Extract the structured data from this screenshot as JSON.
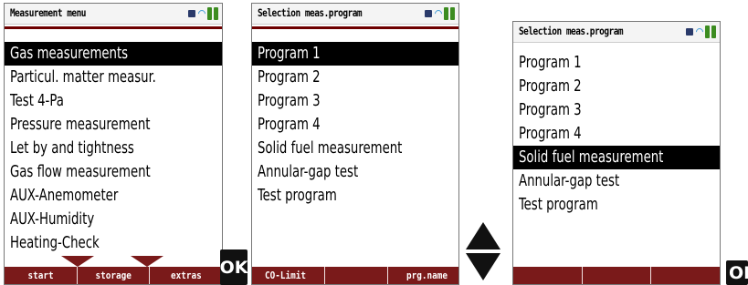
{
  "screen1": {
    "title": "Measurement menu",
    "items": [
      {
        "label": "Gas measurements",
        "selected": true
      },
      {
        "label": "Particul. matter measur.",
        "selected": false
      },
      {
        "label": "Test 4-Pa",
        "selected": false
      },
      {
        "label": "Pressure measurement",
        "selected": false
      },
      {
        "label": "Let by and tightness",
        "selected": false
      },
      {
        "label": "Gas flow measurement",
        "selected": false
      },
      {
        "label": "AUX-Anemometer",
        "selected": false
      },
      {
        "label": "AUX-Humidity",
        "selected": false
      },
      {
        "label": "Heating-Check",
        "selected": false
      }
    ],
    "softkeys": [
      "start",
      "storage",
      "extras"
    ]
  },
  "screen2": {
    "title": "Selection meas.program",
    "items": [
      {
        "label": "Program 1",
        "selected": true
      },
      {
        "label": "Program 2",
        "selected": false
      },
      {
        "label": "Program 3",
        "selected": false
      },
      {
        "label": "Program 4",
        "selected": false
      },
      {
        "label": "Solid fuel measurement",
        "selected": false
      },
      {
        "label": "Annular-gap test",
        "selected": false
      },
      {
        "label": "Test program",
        "selected": false
      }
    ],
    "softkeys": [
      "CO-Limit",
      "",
      "prg.name"
    ]
  },
  "screen3": {
    "title": "Selection meas.program",
    "items": [
      {
        "label": "Program 1",
        "selected": false
      },
      {
        "label": "Program 2",
        "selected": false
      },
      {
        "label": "Program 3",
        "selected": false
      },
      {
        "label": "Program 4",
        "selected": false
      },
      {
        "label": "Solid fuel measurement",
        "selected": true
      },
      {
        "label": "Annular-gap test",
        "selected": false
      },
      {
        "label": "Test program",
        "selected": false
      }
    ],
    "softkeys": [
      "",
      "",
      ""
    ]
  },
  "buttons": {
    "ok1": "OK",
    "ok2": "OK"
  },
  "colors": {
    "accent": "#7a1a1a",
    "selection": "#000000",
    "battery": "#3c8c20",
    "signal": "#4aa0d8"
  },
  "icons": [
    "device-icon",
    "signal-icon",
    "battery-icon",
    "up-down-arrow-icon",
    "ok-key-icon"
  ]
}
